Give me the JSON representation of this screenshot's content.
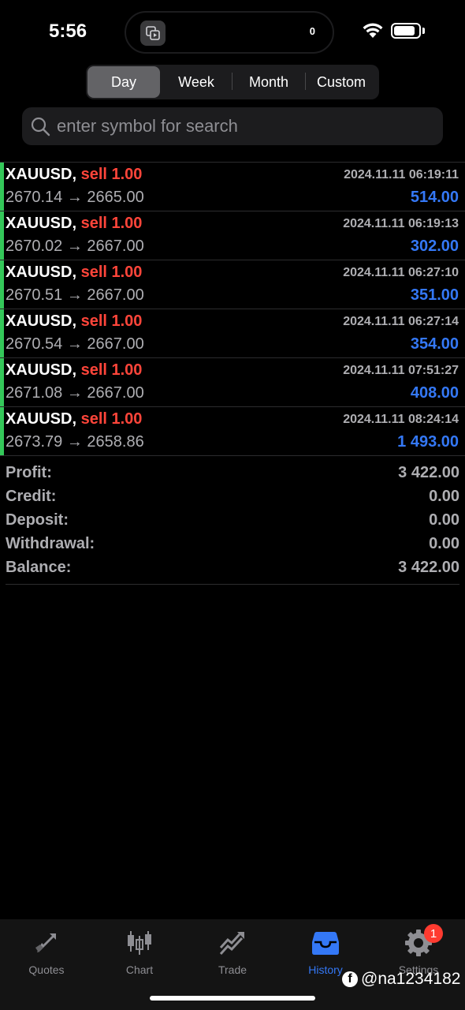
{
  "status_bar": {
    "time": "5:56",
    "island_count": "0"
  },
  "periods": [
    "Day",
    "Week",
    "Month",
    "Custom"
  ],
  "search": {
    "placeholder": "enter symbol for search"
  },
  "trades": [
    {
      "symbol": "XAUUSD,",
      "side": "sell 1.00",
      "datetime": "2024.11.11 06:19:11",
      "open": "2670.14",
      "arrow": "→",
      "close": "2665.00",
      "profit": "514.00"
    },
    {
      "symbol": "XAUUSD,",
      "side": "sell 1.00",
      "datetime": "2024.11.11 06:19:13",
      "open": "2670.02",
      "arrow": "→",
      "close": "2667.00",
      "profit": "302.00"
    },
    {
      "symbol": "XAUUSD,",
      "side": "sell 1.00",
      "datetime": "2024.11.11 06:27:10",
      "open": "2670.51",
      "arrow": "→",
      "close": "2667.00",
      "profit": "351.00"
    },
    {
      "symbol": "XAUUSD,",
      "side": "sell 1.00",
      "datetime": "2024.11.11 06:27:14",
      "open": "2670.54",
      "arrow": "→",
      "close": "2667.00",
      "profit": "354.00"
    },
    {
      "symbol": "XAUUSD,",
      "side": "sell 1.00",
      "datetime": "2024.11.11 07:51:27",
      "open": "2671.08",
      "arrow": "→",
      "close": "2667.00",
      "profit": "408.00"
    },
    {
      "symbol": "XAUUSD,",
      "side": "sell 1.00",
      "datetime": "2024.11.11 08:24:14",
      "open": "2673.79",
      "arrow": "→",
      "close": "2658.86",
      "profit": "1 493.00"
    }
  ],
  "summary": [
    {
      "label": "Profit:",
      "value": "3 422.00"
    },
    {
      "label": "Credit:",
      "value": "0.00"
    },
    {
      "label": "Deposit:",
      "value": "0.00"
    },
    {
      "label": "Withdrawal:",
      "value": "0.00"
    },
    {
      "label": "Balance:",
      "value": "3 422.00"
    }
  ],
  "tabs": [
    {
      "label": "Quotes",
      "icon": "quotes-icon"
    },
    {
      "label": "Chart",
      "icon": "candlestick-icon"
    },
    {
      "label": "Trade",
      "icon": "trade-icon"
    },
    {
      "label": "History",
      "icon": "history-inbox-icon"
    },
    {
      "label": "Settings",
      "icon": "gear-icon"
    }
  ],
  "settings_badge": "1",
  "watermark": "@na1234182",
  "colors": {
    "accent": "#3478f6",
    "sell": "#ff453a",
    "trade_bar": "#34c759",
    "background": "#000000"
  }
}
